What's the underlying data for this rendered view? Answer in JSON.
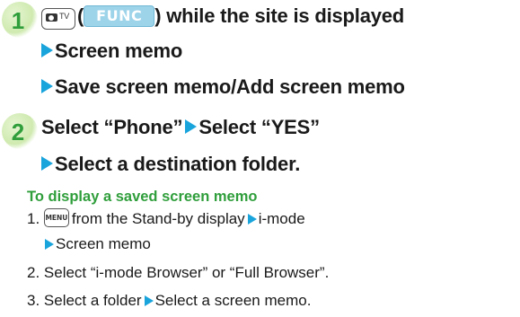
{
  "step1": {
    "number": "1",
    "camera_key_tv": "TV",
    "func_key": "FUNC",
    "text_after_key": ") while the site is displayed",
    "paren_open": "(",
    "line2": "Screen memo",
    "line3": "Save screen memo/Add screen memo"
  },
  "step2": {
    "number": "2",
    "line1_a": "Select “Phone”",
    "line1_b": "Select “YES”",
    "line2": "Select a destination folder."
  },
  "saved_memo": {
    "heading": "To display a saved screen memo",
    "item1_num": "1.",
    "menu_key": "MENU",
    "item1_a": "from the Stand-by display",
    "item1_b": "i-mode",
    "item1_c": "Screen memo",
    "item2": "2. Select “i-mode Browser” or “Full Browser”.",
    "item3_a": "3. Select a folder",
    "item3_b": "Select a screen memo."
  },
  "colors": {
    "arrow": "#1aa4dc",
    "step_number": "#2f9e3b",
    "heading": "#2f9e3b",
    "func_key_bg": "#9ed4ea"
  },
  "icons": {
    "arrow": "right-triangle-icon",
    "camera_key": "camera-tv-key-icon",
    "menu_key": "menu-key-icon"
  }
}
